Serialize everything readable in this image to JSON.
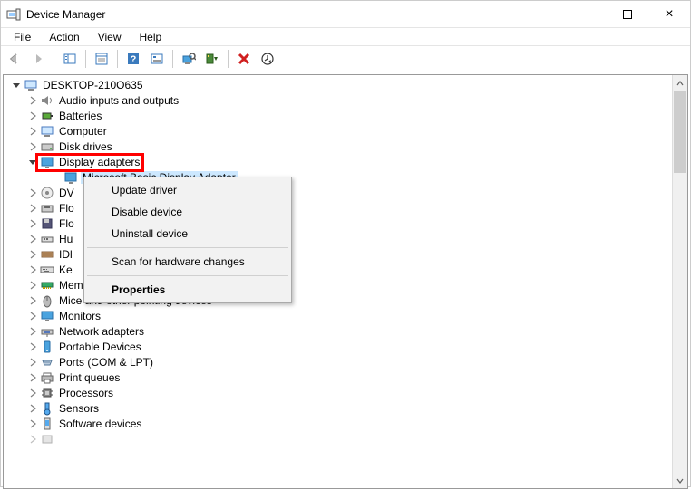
{
  "window": {
    "title": "Device Manager"
  },
  "menu": {
    "file": "File",
    "action": "Action",
    "view": "View",
    "help": "Help"
  },
  "tree": {
    "root": "DESKTOP-210O635",
    "audio": "Audio inputs and outputs",
    "batteries": "Batteries",
    "computer": "Computer",
    "disk_drives": "Disk drives",
    "display_adapters": "Display adapters",
    "display_child": "Microsoft Basic Display Adapter",
    "dv": "DV",
    "flo1": "Flo",
    "flo2": "Flo",
    "hu": "Hu",
    "idl": "IDl",
    "ke": "Ke",
    "memory": "Memory devices",
    "mice": "Mice and other pointing devices",
    "monitors": "Monitors",
    "network": "Network adapters",
    "portable": "Portable Devices",
    "ports": "Ports (COM & LPT)",
    "print_queues": "Print queues",
    "processors": "Processors",
    "sensors": "Sensors",
    "software": "Software devices"
  },
  "context_menu": {
    "update_driver": "Update driver",
    "disable_device": "Disable device",
    "uninstall_device": "Uninstall device",
    "scan": "Scan for hardware changes",
    "properties": "Properties"
  }
}
